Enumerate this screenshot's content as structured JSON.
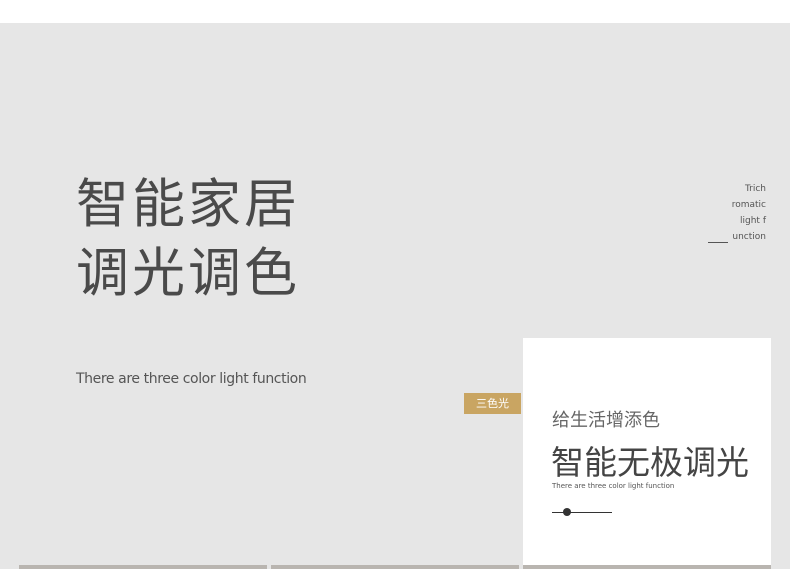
{
  "hero": {
    "title_line1": "智能家居",
    "title_line2": "调光调色",
    "subtitle": "There are three color light function"
  },
  "side_caption": {
    "line1": "Trich",
    "line2": "romatic",
    "line3": "light f",
    "line4": "unction"
  },
  "tag": {
    "label": "三色光",
    "color": "#c9a562"
  },
  "card": {
    "kicker": "给生活增添色",
    "title": "智能无极调光",
    "caption": "There are three color light function",
    "slider_level": 0.2
  },
  "colors": {
    "background": "#e6e6e6",
    "card": "#ffffff",
    "accent": "#c9a562"
  }
}
